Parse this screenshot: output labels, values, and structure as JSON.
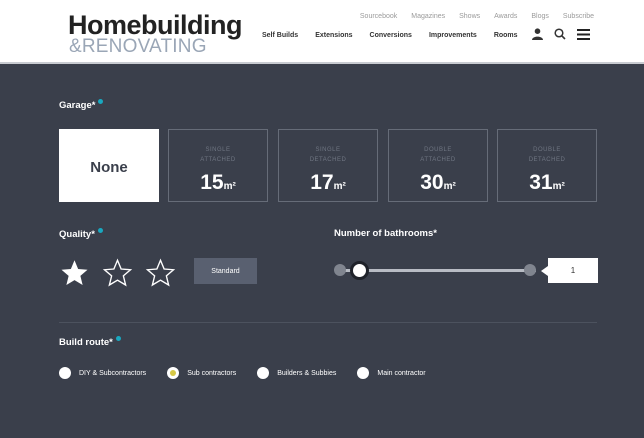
{
  "brand": {
    "logo_top": "Homebuilding",
    "logo_bottom": "&RENOVATING"
  },
  "header": {
    "top_links": [
      "Sourcebook",
      "Magazines",
      "Shows",
      "Awards",
      "Blogs",
      "Subscribe"
    ],
    "main_nav": [
      "Self Builds",
      "Extensions",
      "Conversions",
      "Improvements",
      "Rooms"
    ],
    "icons": [
      "user-icon",
      "search-icon",
      "menu-icon"
    ]
  },
  "garage": {
    "label": "Garage*",
    "options": [
      {
        "top": "",
        "number": "",
        "unit": "",
        "text": "None",
        "selected": true
      },
      {
        "top": "SINGLE ATTACHED",
        "number": "15",
        "unit": "m²",
        "selected": false
      },
      {
        "top": "SINGLE DETACHED",
        "number": "17",
        "unit": "m²",
        "selected": false
      },
      {
        "top": "DOUBLE ATTACHED",
        "number": "30",
        "unit": "m²",
        "selected": false
      },
      {
        "top": "DOUBLE DETACHED",
        "number": "31",
        "unit": "m²",
        "selected": false
      }
    ]
  },
  "quality": {
    "label": "Quality*",
    "rating": 1,
    "max": 3,
    "badge": "Standard"
  },
  "bathrooms": {
    "label": "Number of bathrooms*",
    "value": "1"
  },
  "build_route": {
    "label": "Build route*",
    "options": [
      {
        "label": "DIY & Subcontractors",
        "checked": false
      },
      {
        "label": "Sub contractors",
        "checked": true
      },
      {
        "label": "Builders & Subbies",
        "checked": false
      },
      {
        "label": "Main contractor",
        "checked": false
      }
    ]
  },
  "colors": {
    "background": "#3a3f4b",
    "accent": "#19a8c0",
    "radio_checked": "#d6c845"
  }
}
